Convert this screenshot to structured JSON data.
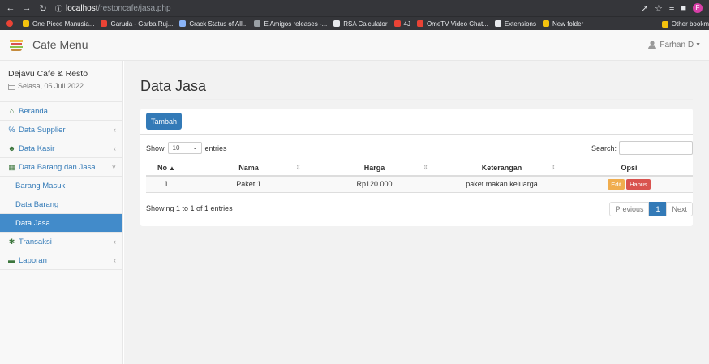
{
  "browser": {
    "url_host": "localhost",
    "url_path": "/restoncafe/jasa.php",
    "bookmarks": [
      {
        "label": "One Piece Manusia...",
        "color": "#f4c20d"
      },
      {
        "label": "Garuda - Garba Ruj...",
        "color": "#ea4335"
      },
      {
        "label": "Crack Status of All...",
        "color": "#8ab4f8"
      },
      {
        "label": "ElAmigos releases -...",
        "color": "#9aa0a6"
      },
      {
        "label": "RSA Calculator",
        "color": "#e8eaed"
      },
      {
        "label": "4J",
        "color": "#ea4335"
      },
      {
        "label": "OmeTV Video Chat...",
        "color": "#ea4335"
      },
      {
        "label": "Extensions",
        "color": "#e8eaed"
      },
      {
        "label": "New folder",
        "color": "#f4c20d"
      }
    ],
    "other_bookmarks": "Other bookm",
    "profile_initial": "F"
  },
  "navbar": {
    "brand": "Cafe Menu",
    "user": "Farhan D"
  },
  "sidebar": {
    "title": "Dejavu Cafe & Resto",
    "date": "Selasa, 05 Juli 2022",
    "items": [
      {
        "label": "Beranda",
        "icon": "home-icon",
        "glyph": "⌂"
      },
      {
        "label": "Data Supplier",
        "icon": "link-icon",
        "glyph": "%"
      },
      {
        "label": "Data Kasir",
        "icon": "users-icon",
        "glyph": "☻"
      },
      {
        "label": "Data Barang dan Jasa",
        "icon": "th-icon",
        "glyph": "▦"
      }
    ],
    "sub_items": [
      "Barang Masuk",
      "Data Barang",
      "Data Jasa"
    ],
    "items_after": [
      {
        "label": "Transaksi",
        "icon": "cog-icon",
        "glyph": "✱"
      },
      {
        "label": "Laporan",
        "icon": "folder-icon",
        "glyph": "▬"
      }
    ]
  },
  "main": {
    "title": "Data Jasa",
    "add_label": "Tambah",
    "show_label": "Show",
    "entries_value": "10",
    "entries_label": "entries",
    "search_label": "Search:",
    "columns": [
      "No",
      "Nama",
      "Harga",
      "Keterangan",
      "Opsi"
    ],
    "rows": [
      {
        "no": "1",
        "nama": "Paket 1",
        "harga": "Rp120.000",
        "keterangan": "paket makan keluarga",
        "edit": "Edit",
        "hapus": "Hapus"
      }
    ],
    "info": "Showing 1 to 1 of 1 entries",
    "pager": {
      "prev": "Previous",
      "current": "1",
      "next": "Next"
    }
  },
  "colors": {
    "primary": "#337ab7",
    "warning": "#f0ad4e",
    "danger": "#d9534f",
    "sidebar_active": "#428bca"
  }
}
